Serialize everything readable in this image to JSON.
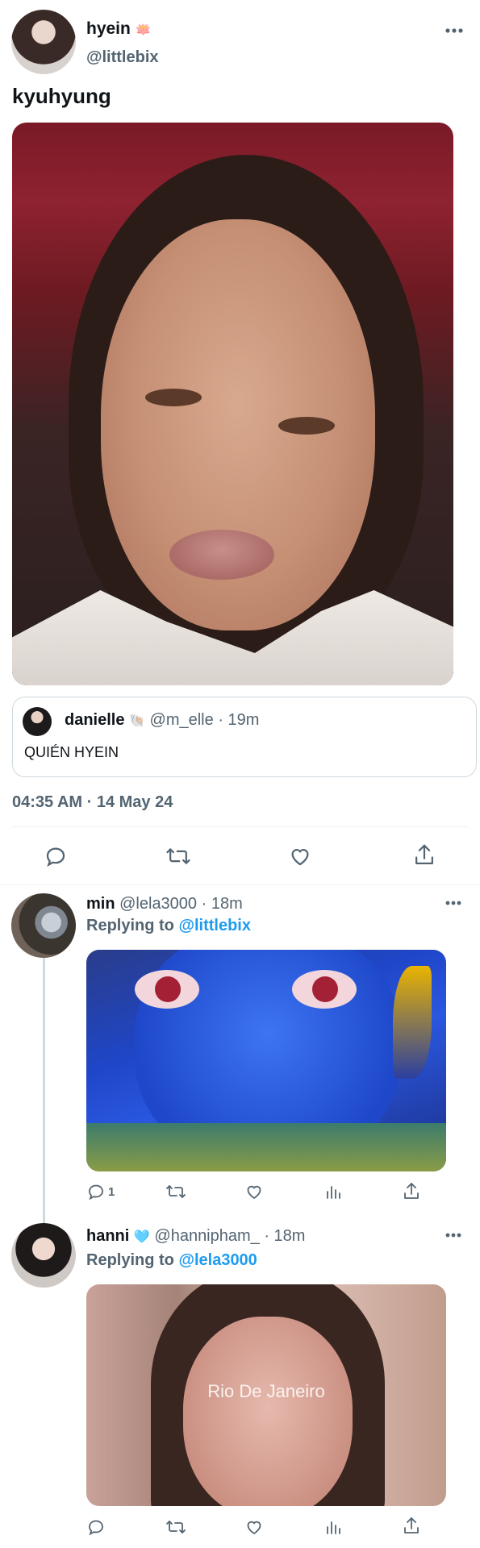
{
  "main_tweet": {
    "author_name": "hyein",
    "author_badge": "🪷",
    "author_handle": "@littlebix",
    "text": "kyuhyung",
    "timestamp": "04:35 AM · 14 May 24",
    "more_icon": "more-horizontal-icon"
  },
  "quoted_tweet": {
    "author_name": "danielle",
    "author_badge": "🐚",
    "author_handle": "@m_elle",
    "time": "· 19m",
    "text": "QUIÉN HYEIN"
  },
  "main_actions": [
    {
      "icon": "reply-icon"
    },
    {
      "icon": "retweet-icon"
    },
    {
      "icon": "like-icon"
    },
    {
      "icon": "share-icon"
    }
  ],
  "replies": [
    {
      "author_name": "min",
      "author_handle": "@lela3000",
      "time": "· 18m",
      "replying_label": "Replying to",
      "replying_to": "@littlebix",
      "reply_count": "1"
    },
    {
      "author_name": "hanni",
      "author_badge": "🩵",
      "author_handle": "@hannipham_",
      "time": "· 18m",
      "replying_label": "Replying to",
      "replying_to": "@lela3000",
      "image_caption": "Rio De Janeiro"
    }
  ],
  "colors": {
    "accent": "#1d9bf0",
    "muted": "#536471",
    "divider": "#eff3f4"
  }
}
